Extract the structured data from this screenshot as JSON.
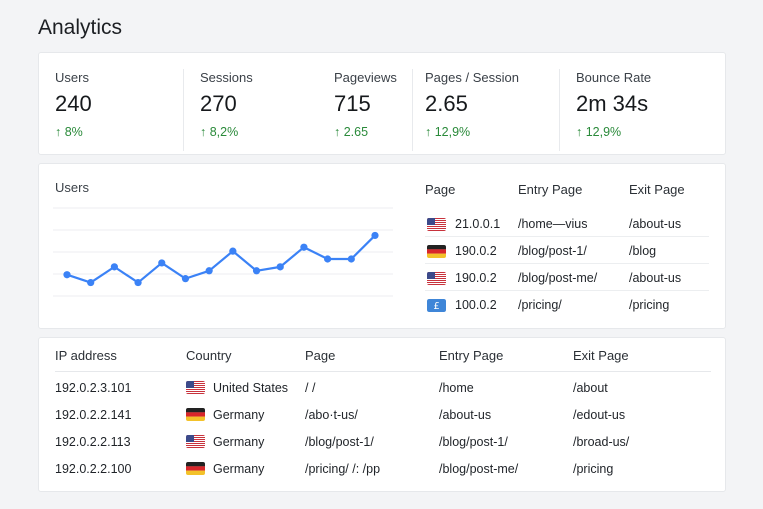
{
  "page": {
    "title": "Analytics"
  },
  "stats": [
    {
      "label": "Users",
      "value": "240",
      "change": "↑ 8%"
    },
    {
      "label": "Sessions",
      "value": "270",
      "change": "↑ 8,2%"
    },
    {
      "label": "Pageviews",
      "value": "715",
      "change": "↑ 2.65"
    },
    {
      "label": "Pages / Session",
      "value": "2.65",
      "change": "↑ 12,9%"
    },
    {
      "label": "Bounce Rate",
      "value": "2m 34s",
      "change": "↑ 12,9%"
    }
  ],
  "colors": {
    "accent": "#3b82f6",
    "positive": "#2a8a3a"
  },
  "chart_data": {
    "type": "line",
    "title": "Users",
    "xlabel": "",
    "ylabel": "",
    "grid": true,
    "series": [
      {
        "values": [
          4,
          2,
          6,
          2,
          7,
          3,
          5,
          10,
          5,
          6,
          11,
          8,
          8,
          14
        ]
      }
    ],
    "ylim": [
      -6,
      22
    ]
  },
  "top_pages": {
    "columns": [
      "Page",
      "Entry Page",
      "Exit Page"
    ],
    "rows": [
      {
        "flag": "us-flag-icon",
        "page": "21.0.0.1",
        "entry": "/home—vius",
        "exit": "/about-us"
      },
      {
        "flag": "de-flag-icon",
        "page": "190.0.2",
        "entry": "/blog/post-1/",
        "exit": "/blog"
      },
      {
        "flag": "us-flag-icon",
        "page": "190.0.2",
        "entry": "/blog/post-me/",
        "exit": "/about-us"
      },
      {
        "flag": "pound-badge-icon",
        "page": "100.0.2",
        "entry": "/pricing/",
        "exit": "/pricing"
      }
    ]
  },
  "visits": {
    "columns": [
      "IP address",
      "Country",
      "Page",
      "Entry Page",
      "Exit Page"
    ],
    "rows": [
      {
        "ip": "192.0.2.3.101",
        "flag": "us-flag-icon",
        "country": "United States",
        "page": "/   /",
        "entry": "/home",
        "exit": "/about"
      },
      {
        "ip": "192.0.2.2.141",
        "flag": "de-flag-icon",
        "country": "Germany",
        "page": "/abo·t-us/",
        "entry": "/about-us",
        "exit": "/edout-us"
      },
      {
        "ip": "192.0.2.2.113",
        "flag": "us-flag-icon",
        "country": "Germany",
        "page": "/blog/post-1/",
        "entry": "/blog/post-1/",
        "exit": "/broad-us/"
      },
      {
        "ip": "192.0.2.2.100",
        "flag": "de-flag-icon",
        "country": "Germany",
        "page": "/pricing/   /: /pp",
        "entry": "/blog/post-me/",
        "exit": "/pricing"
      }
    ]
  }
}
